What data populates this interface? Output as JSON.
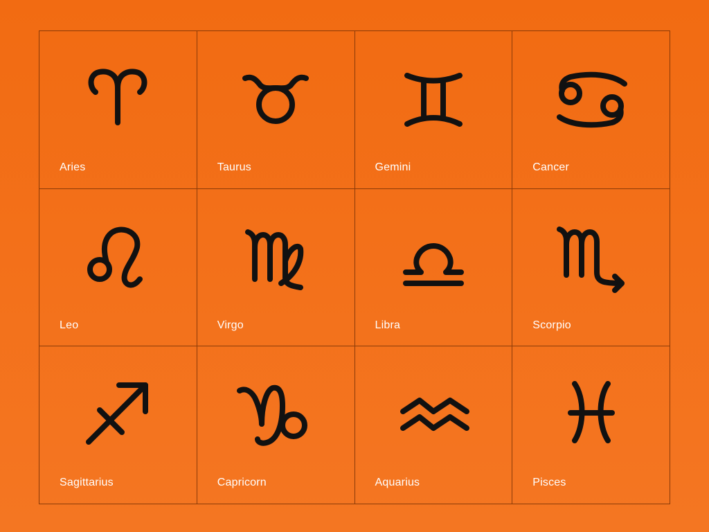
{
  "background_color": "#f26b12",
  "signs": [
    {
      "label": "Aries",
      "icon": "aries-icon"
    },
    {
      "label": "Taurus",
      "icon": "taurus-icon"
    },
    {
      "label": "Gemini",
      "icon": "gemini-icon"
    },
    {
      "label": "Cancer",
      "icon": "cancer-icon"
    },
    {
      "label": "Leo",
      "icon": "leo-icon"
    },
    {
      "label": "Virgo",
      "icon": "virgo-icon"
    },
    {
      "label": "Libra",
      "icon": "libra-icon"
    },
    {
      "label": "Scorpio",
      "icon": "scorpio-icon"
    },
    {
      "label": "Sagittarius",
      "icon": "sagittarius-icon"
    },
    {
      "label": "Capricorn",
      "icon": "capricorn-icon"
    },
    {
      "label": "Aquarius",
      "icon": "aquarius-icon"
    },
    {
      "label": "Pisces",
      "icon": "pisces-icon"
    }
  ]
}
